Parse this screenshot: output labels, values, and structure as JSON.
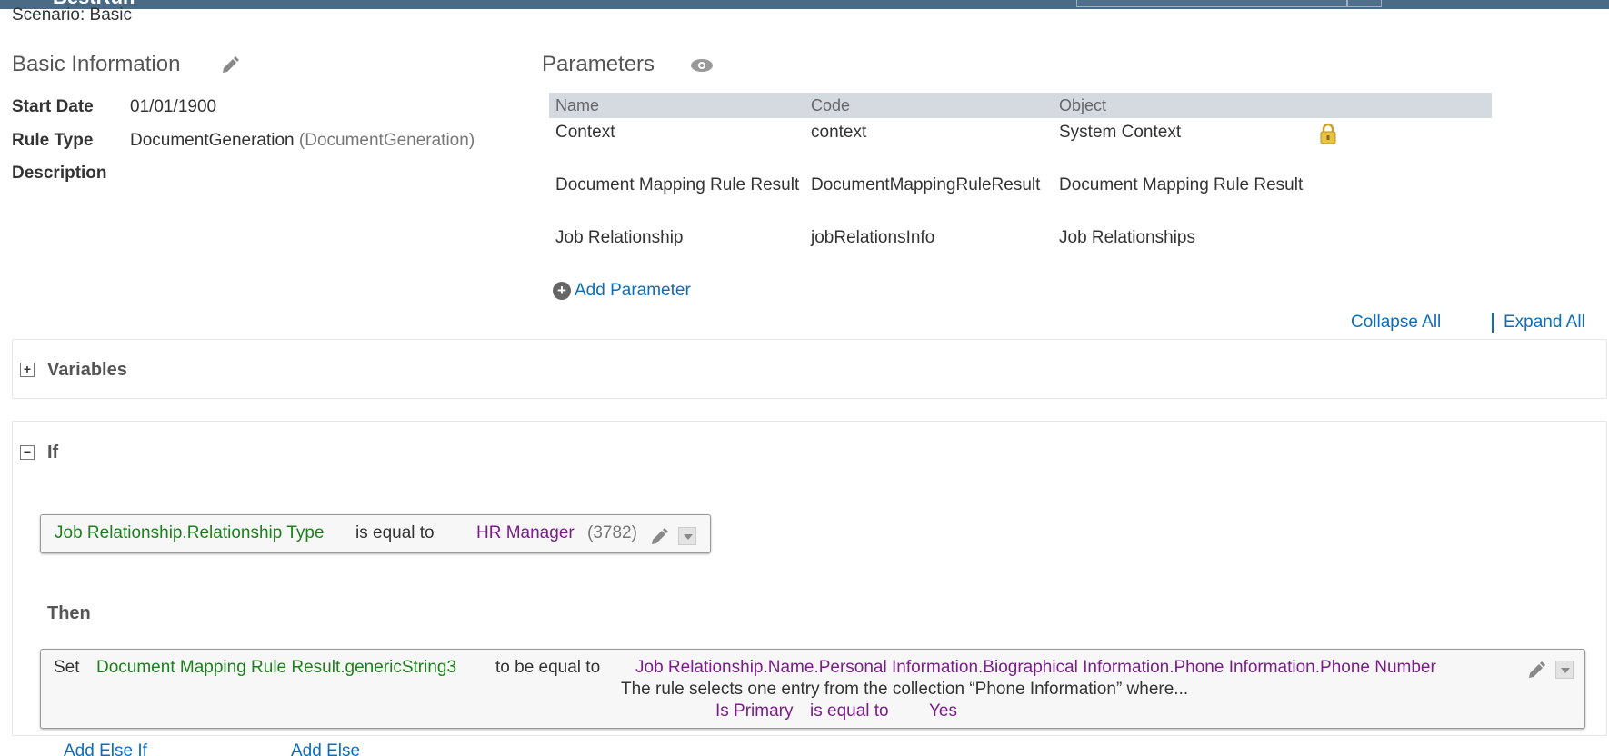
{
  "header": {
    "logo": "BestRun"
  },
  "scenario": "Scenario: Basic",
  "basic_info": {
    "title": "Basic Information",
    "start_date_label": "Start Date",
    "start_date_value": "01/01/1900",
    "rule_type_label": "Rule Type",
    "rule_type_value": "DocumentGeneration",
    "rule_type_code": "(DocumentGeneration)",
    "description_label": "Description"
  },
  "parameters": {
    "title": "Parameters",
    "columns": [
      "Name",
      "Code",
      "Object"
    ],
    "rows": [
      {
        "name": "Context",
        "code": "context",
        "object": "System Context"
      },
      {
        "name": "Document Mapping Rule Result",
        "code": "DocumentMappingRuleResult",
        "object": "Document Mapping Rule Result"
      },
      {
        "name": "Job Relationship",
        "code": "jobRelationsInfo",
        "object": "Job Relationships"
      }
    ],
    "add_label": "Add Parameter"
  },
  "actions": {
    "collapse_all": "Collapse All",
    "expand_all": "Expand All"
  },
  "variables": {
    "title": "Variables",
    "toggle": "+"
  },
  "if_section": {
    "title": "If",
    "toggle": "−",
    "condition": {
      "field": "Job Relationship.Relationship Type",
      "operator": "is equal to",
      "value": "HR Manager",
      "value_code": "(3782)"
    },
    "then_label": "Then",
    "action": {
      "verb": "Set",
      "target": "Document Mapping Rule Result.genericString3",
      "operator": "to be equal to",
      "source": "Job Relationship.Name.Personal Information.Biographical Information.Phone Information.Phone Number",
      "note": "The rule selects one entry from the collection “Phone Information” where...",
      "filter_field": "Is Primary",
      "filter_operator": "is equal to",
      "filter_value": "Yes"
    }
  },
  "footer_links": {
    "add_else_if": "Add Else If",
    "add_else": "Add Else"
  },
  "colors": {
    "link": "#0a6ebd",
    "field_green": "#1e7f1e",
    "value_purple": "#7b1e8a",
    "topbar": "#4a6a86"
  }
}
